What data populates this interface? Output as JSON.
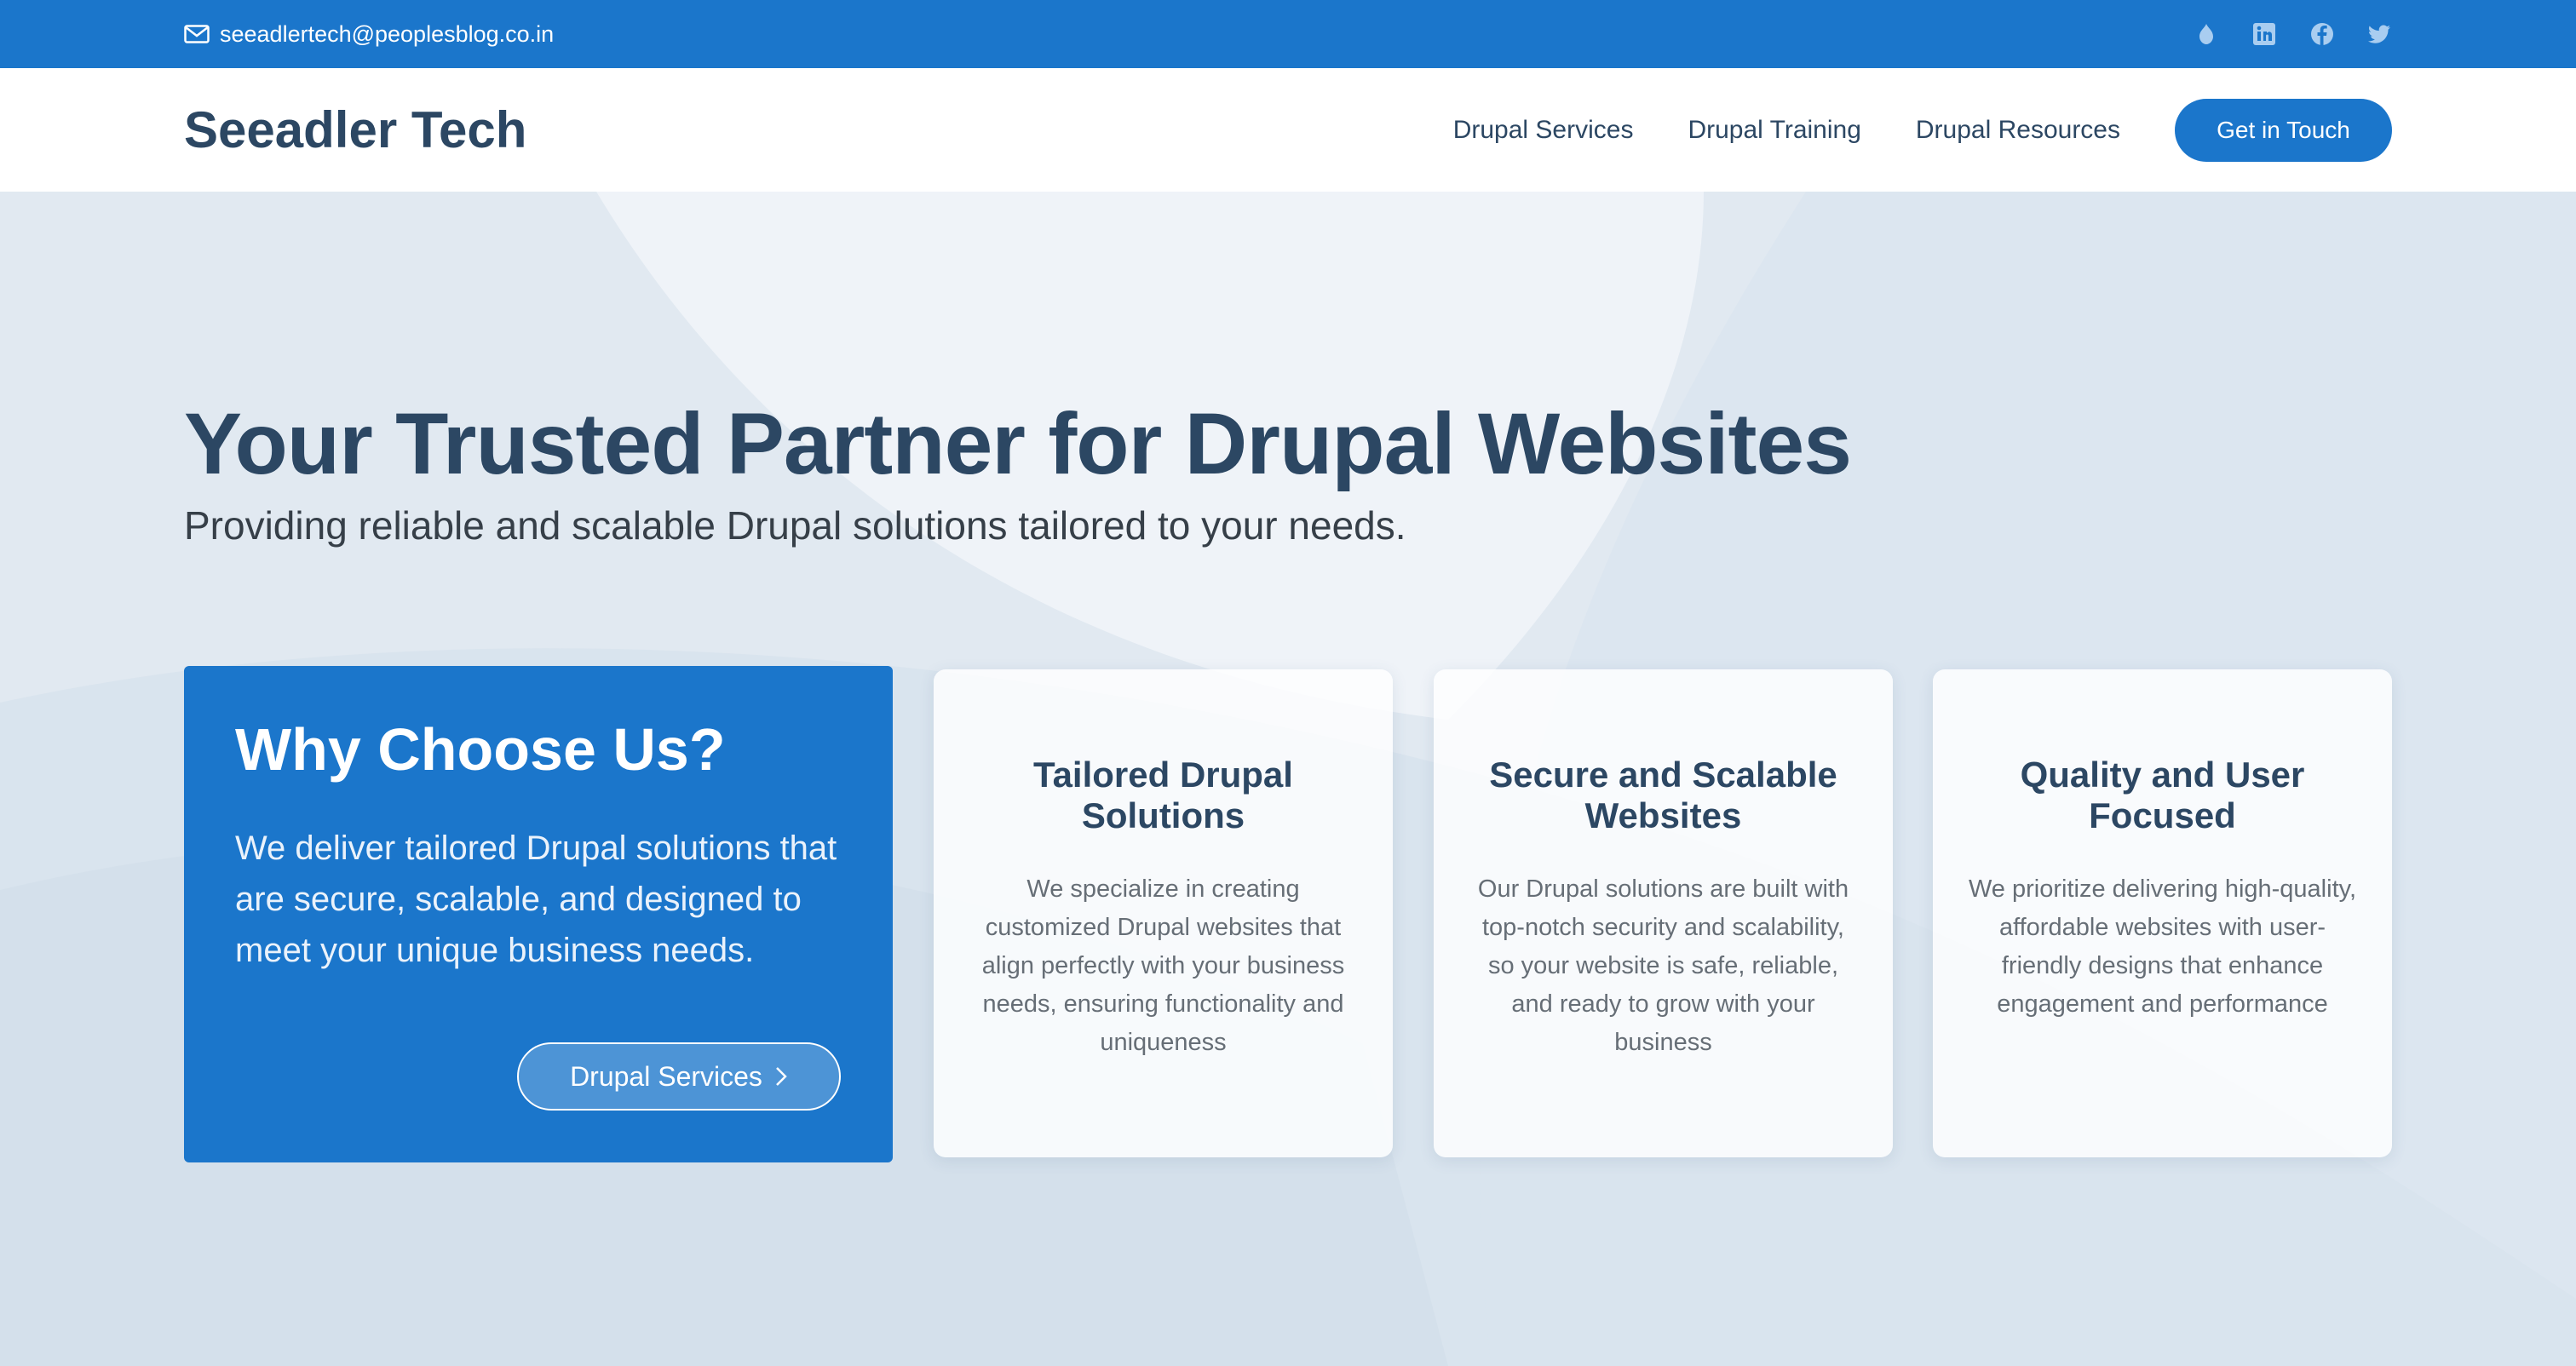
{
  "topbar": {
    "email": "seeadlertech@peoplesblog.co.in",
    "social_icons": [
      "drupal-icon",
      "linkedin-icon",
      "facebook-icon",
      "twitter-icon"
    ]
  },
  "header": {
    "logo": "Seeadler Tech",
    "nav": [
      "Drupal Services",
      "Drupal Training",
      "Drupal Resources"
    ],
    "cta": "Get in Touch"
  },
  "hero": {
    "title": "Your Trusted Partner for Drupal Websites",
    "subtitle": "Providing reliable and scalable Drupal solutions tailored to your needs."
  },
  "why": {
    "title": "Why Choose Us?",
    "text": "We deliver tailored Drupal solutions that are secure, scalable, and designed to meet your unique business needs.",
    "button": "Drupal Services"
  },
  "cards": [
    {
      "title": "Tailored Drupal Solutions",
      "text": "We specialize in creating customized Drupal websites that align perfectly with your business needs, ensuring functionality and uniqueness"
    },
    {
      "title": "Secure and Scalable Websites",
      "text": "Our Drupal solutions are built with top-notch security and scalability, so your website is safe, reliable, and ready to grow with your business"
    },
    {
      "title": "Quality and User Focused",
      "text": "We prioritize delivering high-quality, affordable websites with user-friendly designs that enhance engagement and performance"
    }
  ],
  "colors": {
    "primary": "#1b76cb",
    "heading": "#2c4763",
    "background": "#dde6ef"
  }
}
